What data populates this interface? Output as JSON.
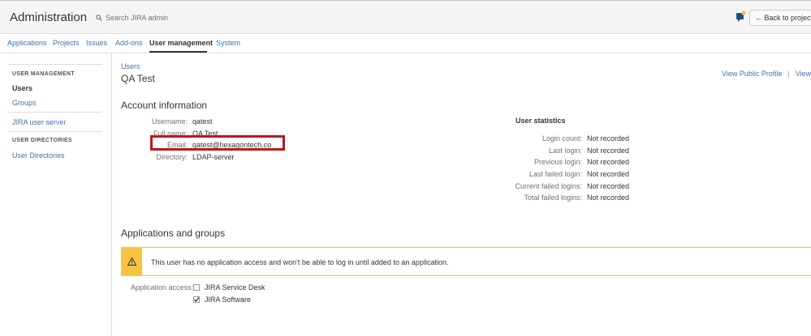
{
  "header": {
    "title": "Administration",
    "search_placeholder": "Search JIRA admin",
    "back_button": "← Back to project: I"
  },
  "nav": {
    "items": [
      "Applications",
      "Projects",
      "Issues",
      "Add-ons",
      "User management",
      "System"
    ],
    "active": "User management"
  },
  "sidebar": {
    "heading_user_management": "USER MANAGEMENT",
    "users": "Users",
    "groups": "Groups",
    "jira_user_server": "JIRA user server",
    "heading_user_directories": "USER DIRECTORIES",
    "user_directories": "User Directories"
  },
  "main": {
    "breadcrumb": "Users",
    "title": "QA Test",
    "view_public_profile": "View Public Profile",
    "view_pr": "View Pr",
    "account_section": "Account information",
    "account": [
      {
        "label": "Username:",
        "value": "qatest"
      },
      {
        "label": "Full name:",
        "value": "QA Test"
      },
      {
        "label": "Email:",
        "value": "qatest@hexagontech.co"
      },
      {
        "label": "Directory:",
        "value": "LDAP-server"
      }
    ],
    "stats_title": "User statistics",
    "stats": [
      {
        "label": "Login count:",
        "value": "Not recorded"
      },
      {
        "label": "Last login:",
        "value": "Not recorded"
      },
      {
        "label": "Previous login:",
        "value": "Not recorded"
      },
      {
        "label": "Last failed login:",
        "value": "Not recorded"
      },
      {
        "label": "Current failed logins:",
        "value": "Not recorded"
      },
      {
        "label": "Total failed logins:",
        "value": "Not recorded"
      }
    ],
    "apps_section": "Applications and groups",
    "warning": "This user has no application access and won't be able to log in until added to an application.",
    "access_label": "Application access:",
    "apps": [
      {
        "name": "JIRA Service Desk",
        "checked": false
      },
      {
        "name": "JIRA Software",
        "checked": true
      }
    ]
  },
  "colors": {
    "link": "#3b73af",
    "warning": "#f6c342",
    "highlight": "#c1161d"
  }
}
